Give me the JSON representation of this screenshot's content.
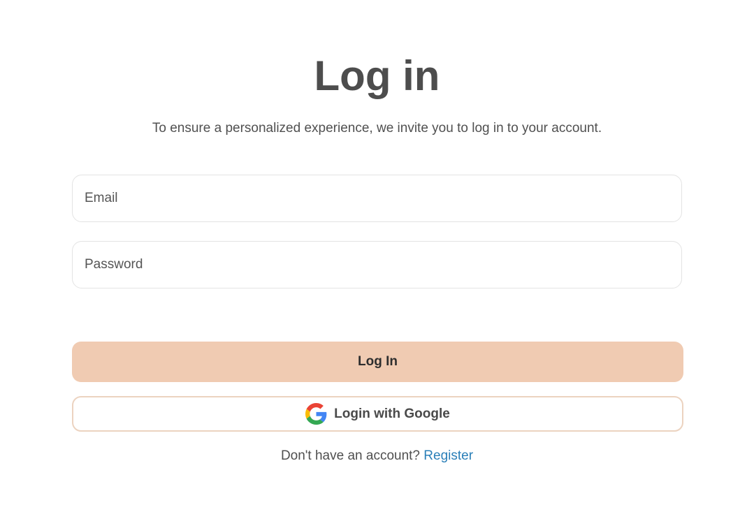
{
  "header": {
    "title": "Log in",
    "subtitle": "To ensure a personalized experience, we invite you to log in to your account."
  },
  "form": {
    "email": {
      "placeholder": "Email",
      "value": ""
    },
    "password": {
      "placeholder": "Password",
      "value": ""
    },
    "login_button_label": "Log In",
    "google_button_label": "Login with Google",
    "google_icon": "google-g-icon"
  },
  "footer": {
    "prompt": "Don't have an account?",
    "register_link": "Register"
  },
  "colors": {
    "primary_button_bg": "#f0cbb2",
    "google_button_border": "#ecd3c0",
    "link": "#2a7fb8",
    "title": "#4d4d4d"
  }
}
